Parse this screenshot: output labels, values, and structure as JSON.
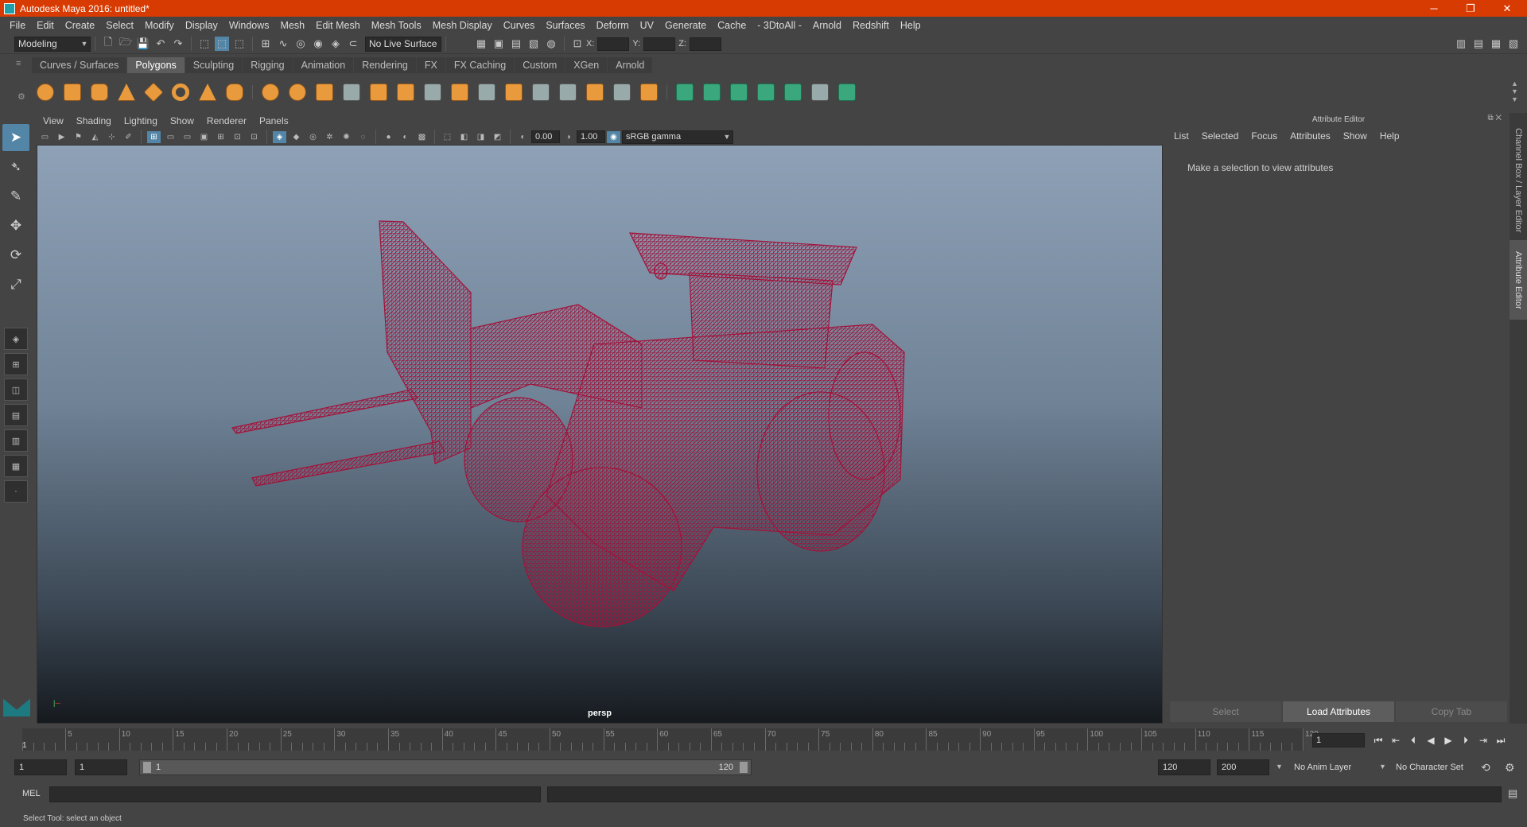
{
  "window": {
    "title": "Autodesk Maya 2016: untitled*",
    "minimize": "─",
    "restore": "❐",
    "close": "✕"
  },
  "menubar": [
    "File",
    "Edit",
    "Create",
    "Select",
    "Modify",
    "Display",
    "Windows",
    "Mesh",
    "Edit Mesh",
    "Mesh Tools",
    "Mesh Display",
    "Curves",
    "Surfaces",
    "Deform",
    "UV",
    "Generate",
    "Cache",
    "- 3DtoAll -",
    "Arnold",
    "Redshift",
    "Help"
  ],
  "statusline": {
    "menuset": "Modeling",
    "live_surface": "No Live Surface",
    "x_label": "X:",
    "y_label": "Y:",
    "z_label": "Z:"
  },
  "shelf_tabs": [
    "Curves / Surfaces",
    "Polygons",
    "Sculpting",
    "Rigging",
    "Animation",
    "Rendering",
    "FX",
    "FX Caching",
    "Custom",
    "XGen",
    "Arnold"
  ],
  "shelf_active": "Polygons",
  "viewport": {
    "menu": [
      "View",
      "Shading",
      "Lighting",
      "Show",
      "Renderer",
      "Panels"
    ],
    "exposure": "0.00",
    "gamma": "1.00",
    "color_space": "sRGB gamma",
    "camera_label": "persp",
    "wire_color": "#a3123a"
  },
  "attribute_editor": {
    "title": "Attribute Editor",
    "menu": [
      "List",
      "Selected",
      "Focus",
      "Attributes",
      "Show",
      "Help"
    ],
    "message": "Make a selection to view attributes",
    "buttons": [
      "Select",
      "Load Attributes",
      "Copy Tab"
    ],
    "side_tabs": [
      "Channel Box / Layer Editor",
      "Attribute Editor"
    ]
  },
  "timeslider": {
    "labels": [
      "5",
      "10",
      "15",
      "20",
      "25",
      "30",
      "35",
      "40",
      "45",
      "50",
      "55",
      "60",
      "65",
      "70",
      "75",
      "80",
      "85",
      "90",
      "95",
      "100",
      "105",
      "110",
      "115",
      "120"
    ],
    "start_label": "1",
    "current_frame": "1",
    "max_frame": 120
  },
  "range": {
    "start": "1",
    "playback_start": "1",
    "slider_start": "1",
    "slider_end": "120",
    "playback_end": "120",
    "end": "200",
    "anim_layer": "No Anim Layer",
    "character_set": "No Character Set"
  },
  "command_line": {
    "lang": "MEL"
  },
  "help_line": "Select Tool: select an object",
  "colors": {
    "title_bar": "#d83b01",
    "accent": "#5285a6",
    "wire": "#a3123a"
  }
}
